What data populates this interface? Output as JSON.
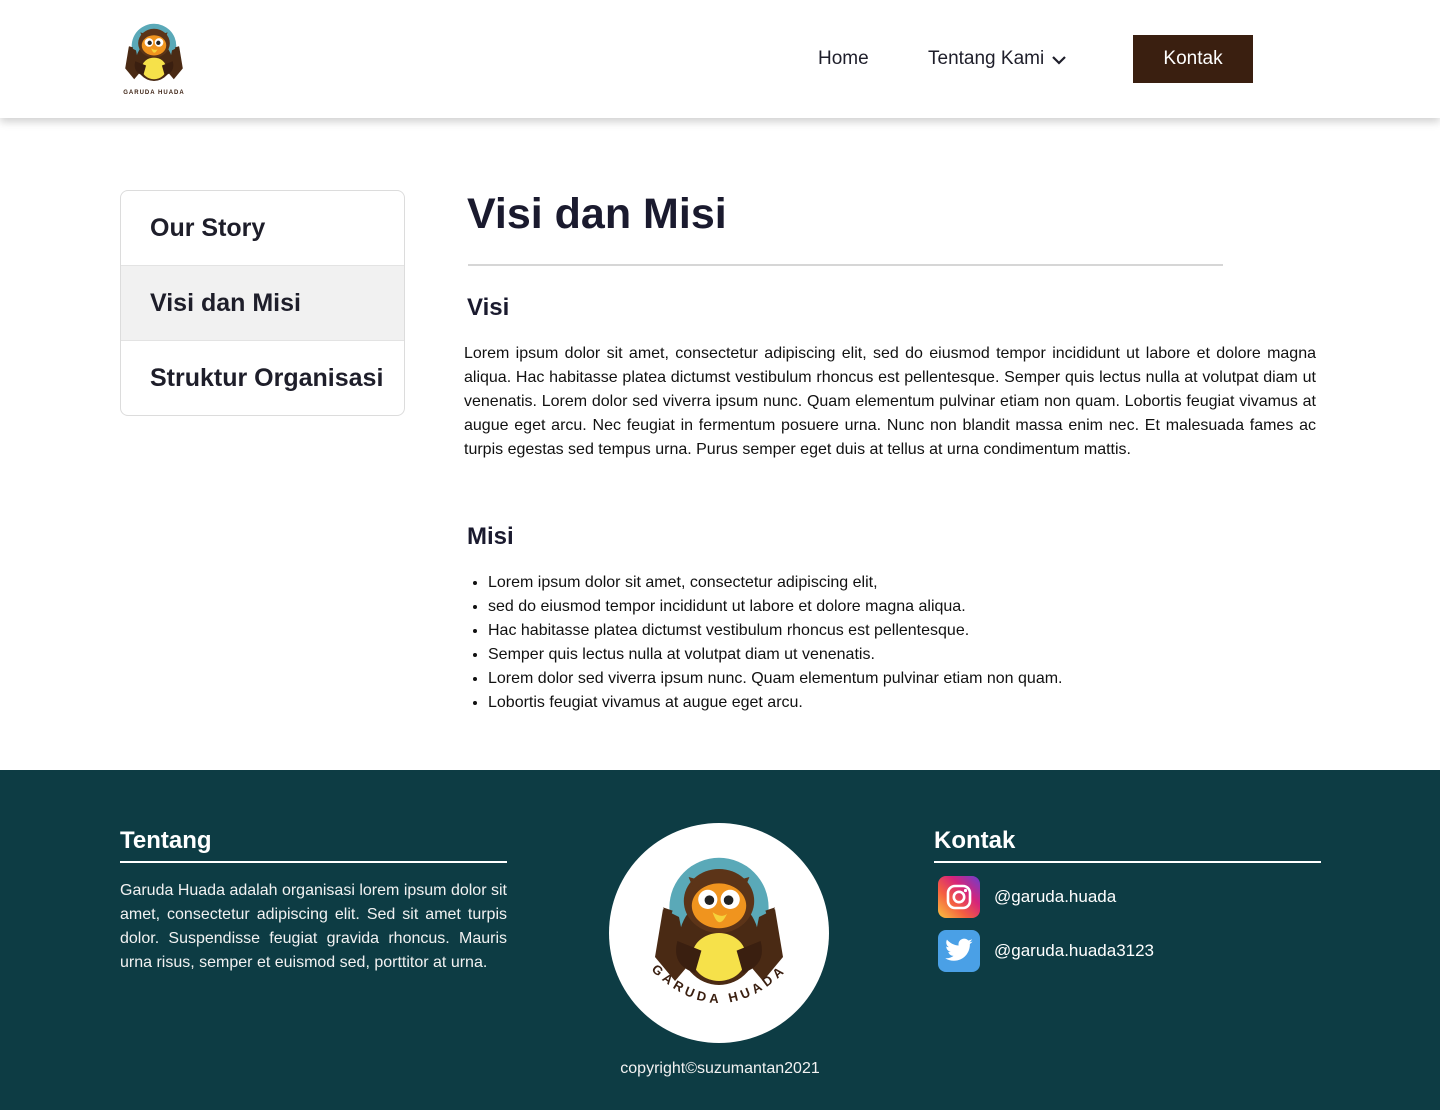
{
  "header": {
    "logo_alt": "Garuda Huada",
    "nav": {
      "home": "Home",
      "about": "Tentang Kami",
      "contact_button": "Kontak"
    }
  },
  "sidebar": {
    "items": [
      {
        "label": "Our Story",
        "active": false
      },
      {
        "label": "Visi dan Misi",
        "active": true
      },
      {
        "label": "Struktur Organisasi",
        "active": false
      }
    ]
  },
  "main": {
    "title": "Visi dan Misi",
    "visi": {
      "heading": "Visi",
      "text": "Lorem ipsum dolor sit amet, consectetur adipiscing elit, sed do eiusmod tempor incididunt ut labore et dolore magna aliqua. Hac habitasse platea dictumst vestibulum rhoncus est pellentesque. Semper quis lectus nulla at volutpat diam ut venenatis. Lorem dolor sed viverra ipsum nunc. Quam elementum pulvinar etiam non quam. Lobortis feugiat vivamus at augue eget arcu. Nec feugiat in fermentum posuere urna. Nunc non blandit massa enim nec. Et malesuada fames ac turpis egestas sed tempus urna. Purus semper eget duis at tellus at urna condimentum mattis."
    },
    "misi": {
      "heading": "Misi",
      "items": [
        "Lorem ipsum dolor sit amet, consectetur adipiscing elit,",
        "sed do eiusmod tempor incididunt ut labore et dolore magna aliqua.",
        "Hac habitasse platea dictumst vestibulum rhoncus est pellentesque.",
        "Semper quis lectus nulla at volutpat diam ut venenatis.",
        "Lorem dolor sed viverra ipsum nunc. Quam elementum pulvinar etiam non quam.",
        "Lobortis feugiat vivamus at augue eget arcu."
      ]
    }
  },
  "footer": {
    "tentang": {
      "heading": "Tentang",
      "text": "Garuda Huada adalah organisasi lorem ipsum dolor sit amet, consectetur adipiscing elit. Sed sit amet turpis dolor. Suspendisse feugiat gravida rhoncus. Mauris urna risus, semper et euismod sed, porttitor at urna."
    },
    "logo_text": "GARUDA HUADA",
    "kontak": {
      "heading": "Kontak",
      "instagram": {
        "handle": "@garuda.huada",
        "icon": "instagram-icon"
      },
      "twitter": {
        "handle": "@garuda.huada3123",
        "icon": "twitter-icon"
      }
    },
    "copyright": "copyright©suzumantan2021"
  },
  "colors": {
    "button_bg": "#3a1f10",
    "footer_bg": "#0d3c44",
    "active_sidebar_bg": "#f1f1f1",
    "logo_circle": "#5aa9b8",
    "owl_brown": "#4a2a14",
    "owl_orange": "#f0941e",
    "owl_yellow": "#f6e14a"
  }
}
